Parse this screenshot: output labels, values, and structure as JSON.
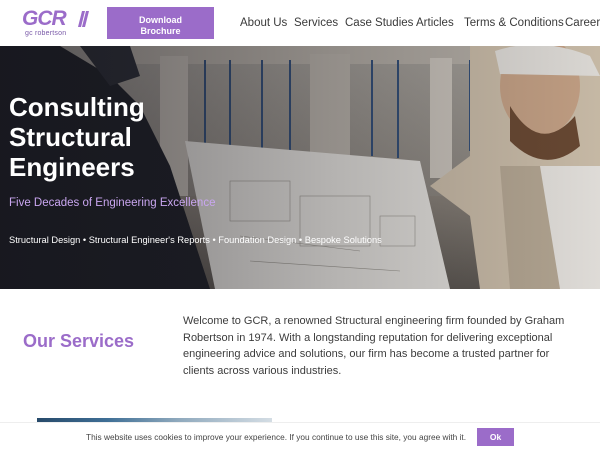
{
  "header": {
    "logo": {
      "mark": "GCR",
      "subtitle": "gc robertson"
    },
    "brochure_button": {
      "line1": "Download",
      "line2": "Brochure"
    },
    "nav": [
      "About Us",
      "Services",
      "Case Studies",
      "Articles",
      "Terms & Conditions",
      "Careers"
    ]
  },
  "hero": {
    "title_lines": [
      "Consulting",
      "Structural",
      "Engineers"
    ],
    "subtitle": "Five Decades of Engineering Excellence",
    "services_line": "Structural Design • Structural Engineer's Reports • Foundation Design • Bespoke Solutions"
  },
  "services": {
    "heading": "Our Services",
    "welcome": "Welcome to GCR, a renowned Structural engineering firm founded by Graham Robertson in 1974. With a longstanding reputation for delivering exceptional engineering advice and solutions, our firm has become a trusted partner for clients across various industries."
  },
  "cookie": {
    "message": "This website uses cookies to improve your experience. If you continue to use this site, you agree with it.",
    "ok_label": "Ok"
  },
  "colors": {
    "accent": "#9b6cc9",
    "hero_subtitle": "#c9a6f0",
    "nav_text": "#3a3a3a"
  }
}
